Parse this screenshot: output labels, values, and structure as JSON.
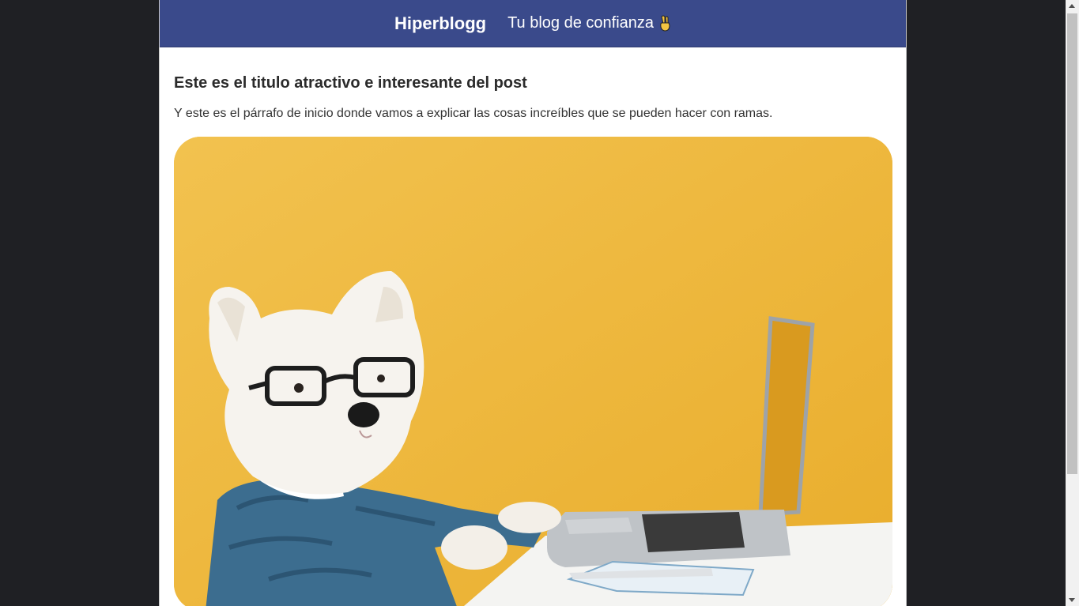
{
  "header": {
    "brand": "Hiperblogg",
    "tagline": "Tu blog de confianza",
    "tagline_icon": "victory-hand-icon",
    "background_color": "#3a4a8b"
  },
  "post": {
    "title": "Este es el titulo atractivo e interesante del post",
    "intro": "Y este es el párrafo de inicio donde vamos a explicar las cosas increíbles que se pueden hacer con ramas.",
    "hero_image_icon": "dog-with-glasses-at-laptop-photo"
  },
  "colors": {
    "page_background": "#1f2024",
    "image_background": "#efb73a"
  }
}
